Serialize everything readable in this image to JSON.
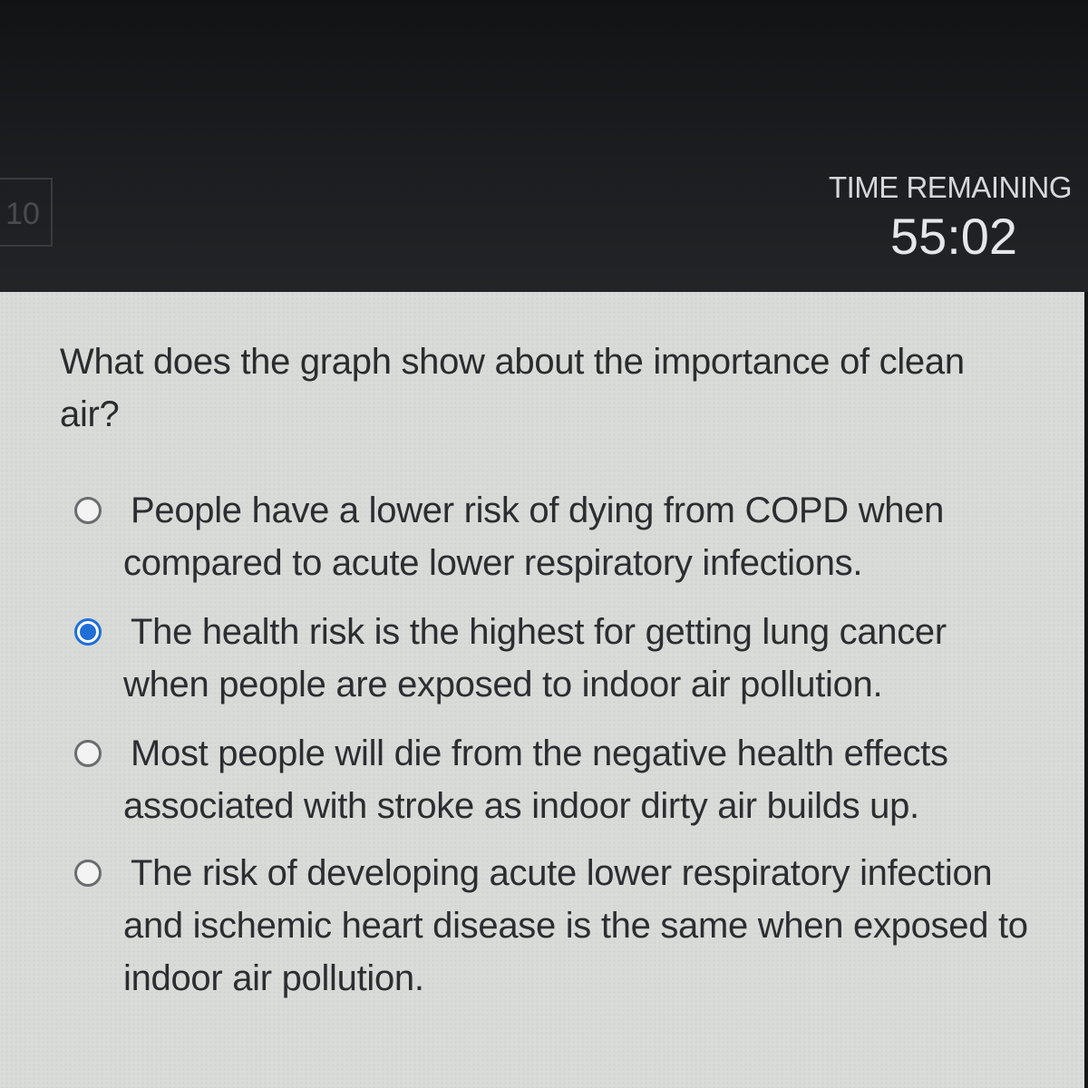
{
  "header": {
    "question_number": "10",
    "timer_label": "TIME REMAINING",
    "timer_value": "55:02"
  },
  "question": {
    "text": "What does the graph show about the importance of clean air?"
  },
  "options": [
    {
      "text": "People have a lower risk of dying from COPD when compared to acute lower respiratory infections.",
      "selected": false
    },
    {
      "text": "The health risk is the highest for getting lung cancer when people are exposed to indoor air pollution.",
      "selected": true
    },
    {
      "text": "Most people will die from the negative health effects associated with stroke as indoor dirty air builds up.",
      "selected": false
    },
    {
      "text": "The risk of developing acute lower respiratory infection and ischemic heart disease is the same when exposed to indoor air pollution.",
      "selected": false
    }
  ],
  "colors": {
    "accent": "#1f6fd6",
    "background_dark": "#151618",
    "content_background": "#d8dbd8"
  }
}
